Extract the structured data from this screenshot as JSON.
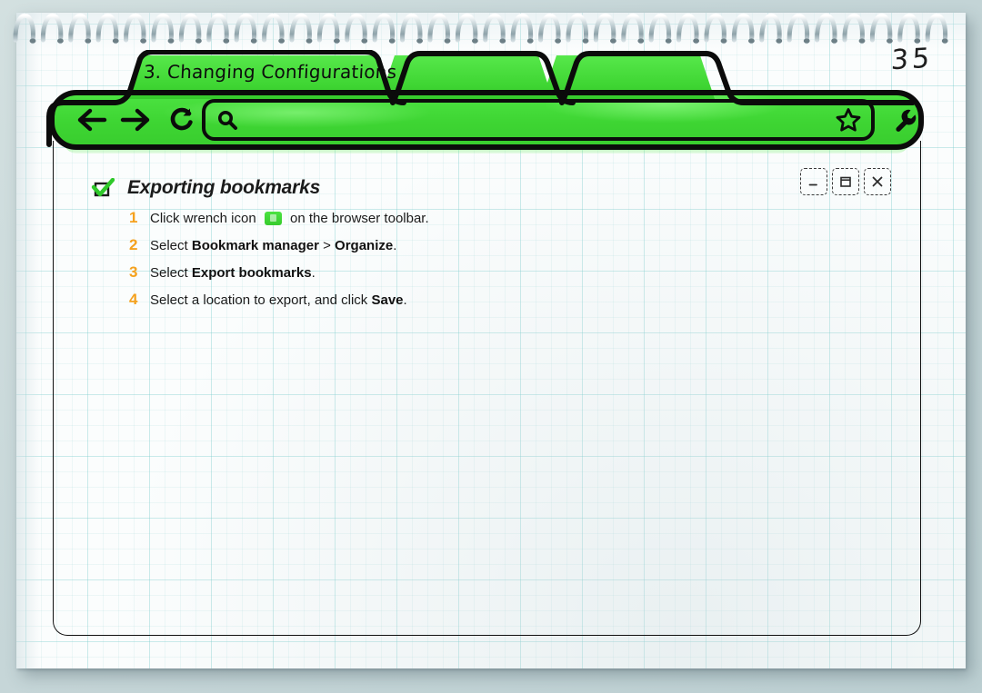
{
  "page": {
    "number": "35",
    "background_color": "#c6d6d8",
    "paper_color": "#fbfdfd",
    "grid_color": "#78cdcd"
  },
  "browser": {
    "accent_color": "#3ed533",
    "outline_color": "#0b0b0b",
    "tabs": [
      {
        "label": "3. Changing Configurations",
        "active": true
      },
      {
        "label": "",
        "active": false
      },
      {
        "label": "",
        "active": false
      }
    ],
    "toolbar": {
      "back_icon": "arrow-left-icon",
      "forward_icon": "arrow-right-icon",
      "reload_icon": "reload-icon",
      "search_icon": "search-icon",
      "bookmark_icon": "star-icon",
      "wrench_icon": "wrench-icon",
      "address_value": "",
      "address_placeholder": ""
    },
    "window_controls": [
      {
        "name": "minimize-button",
        "glyph": "minimize-icon"
      },
      {
        "name": "maximize-button",
        "glyph": "maximize-icon"
      },
      {
        "name": "close-button",
        "glyph": "close-icon"
      }
    ]
  },
  "content": {
    "marker_icon": "checkmark-bookmark-icon",
    "title": "Exporting bookmarks",
    "number_color": "#f5a11e",
    "steps": [
      {
        "num": "1",
        "parts": [
          {
            "text": "Click wrench icon ",
            "bold": false
          },
          {
            "icon": "wrench-swatch-icon"
          },
          {
            "text": " on the browser toolbar.",
            "bold": false
          }
        ]
      },
      {
        "num": "2",
        "parts": [
          {
            "text": "Select ",
            "bold": false
          },
          {
            "text": "Bookmark manager",
            "bold": true
          },
          {
            "text": " > ",
            "bold": false
          },
          {
            "text": "Organize",
            "bold": true
          },
          {
            "text": ".",
            "bold": false
          }
        ]
      },
      {
        "num": "3",
        "parts": [
          {
            "text": "Select ",
            "bold": false
          },
          {
            "text": "Export bookmarks",
            "bold": true
          },
          {
            "text": ".",
            "bold": false
          }
        ]
      },
      {
        "num": "4",
        "parts": [
          {
            "text": "Select a location to export, and click ",
            "bold": false
          },
          {
            "text": "Save",
            "bold": true
          },
          {
            "text": ".",
            "bold": false
          }
        ]
      }
    ]
  }
}
